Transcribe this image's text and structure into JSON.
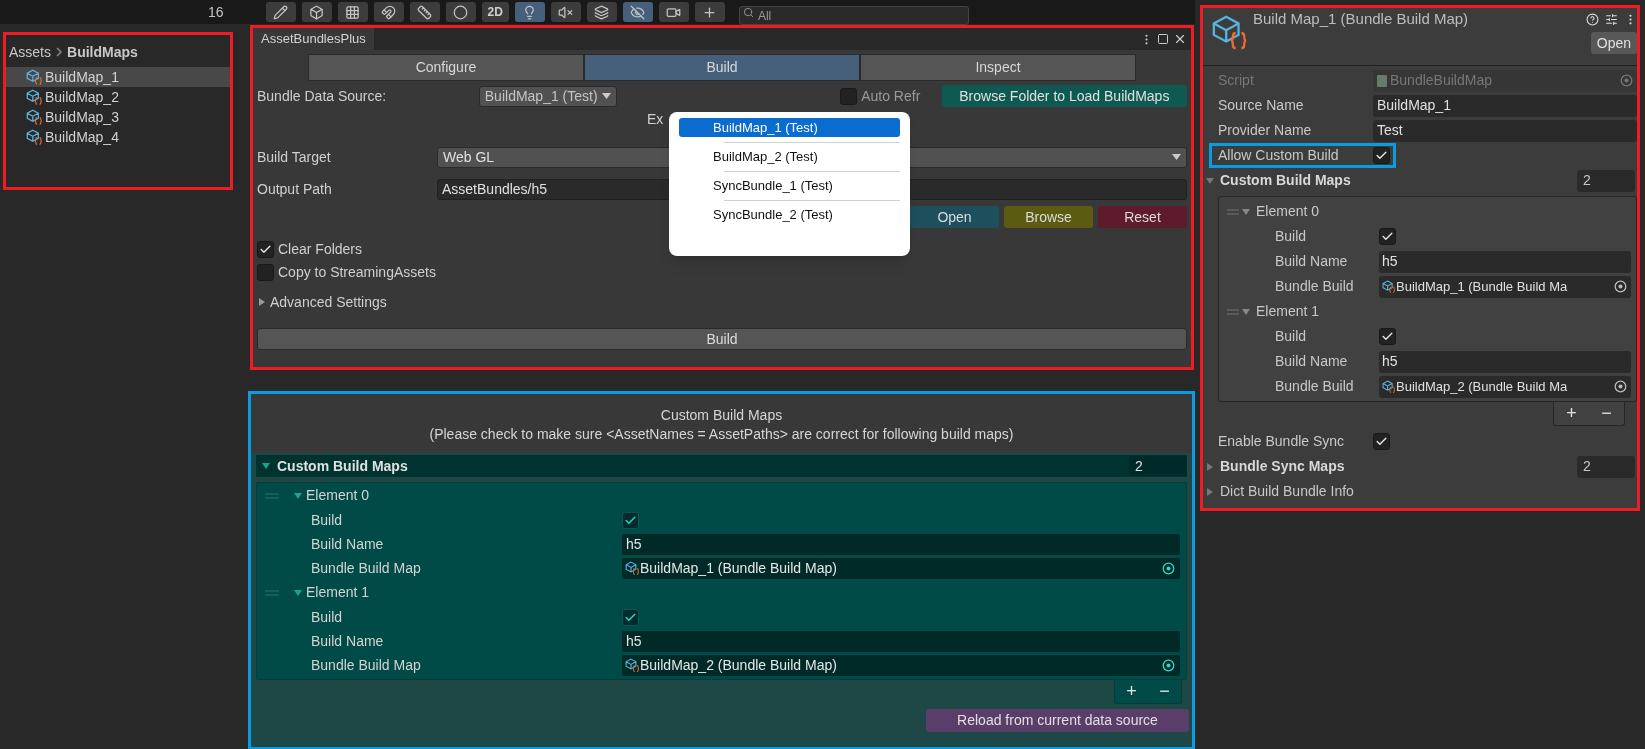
{
  "toolbar": {
    "count": "16",
    "mode_2d": "2D",
    "search": {
      "placeholder": "All"
    },
    "toggles": [
      {
        "kind": "draw",
        "selected": false
      },
      {
        "kind": "gizmo",
        "selected": false
      },
      {
        "kind": "grid",
        "selected": false
      },
      {
        "kind": "snap",
        "selected": false
      },
      {
        "kind": "ruler",
        "selected": false
      },
      {
        "kind": "shading",
        "selected": false
      },
      {
        "kind": "light",
        "selected": true
      },
      {
        "kind": "audio",
        "selected": false
      },
      {
        "kind": "layers",
        "selected": false
      },
      {
        "kind": "hidden",
        "selected": true
      },
      {
        "kind": "camera",
        "selected": false
      },
      {
        "kind": "add",
        "selected": false
      }
    ]
  },
  "project_panel": {
    "breadcrumb": [
      "Assets",
      "BuildMaps"
    ],
    "items": [
      {
        "label": "BuildMap_1",
        "selected": true
      },
      {
        "label": "BuildMap_2",
        "selected": false
      },
      {
        "label": "BuildMap_3",
        "selected": false
      },
      {
        "label": "BuildMap_4",
        "selected": false
      }
    ]
  },
  "bundles_window": {
    "title": "AssetBundlesPlus",
    "tabs": [
      {
        "label": "Configure",
        "selected": false
      },
      {
        "label": "Build",
        "selected": true
      },
      {
        "label": "Inspect",
        "selected": false
      }
    ],
    "data_source": {
      "label": "Bundle Data Source:",
      "value": "BuildMap_1 (Test)"
    },
    "auto_refresh": {
      "label": "Auto Refr",
      "checked": false
    },
    "browse_folder_button": "Browse Folder to Load BuildMaps",
    "export_label": "Ex",
    "build_target": {
      "label": "Build Target",
      "value": "Web GL"
    },
    "output_path": {
      "label": "Output Path",
      "value": "AssetBundles/h5"
    },
    "path_buttons": [
      {
        "label": "Open",
        "color": "#1d4f5c"
      },
      {
        "label": "Browse",
        "color": "#5b5b12"
      },
      {
        "label": "Reset",
        "color": "#5e1b2b"
      }
    ],
    "options": [
      {
        "label": "Clear Folders",
        "checked": true
      },
      {
        "label": "Copy to StreamingAssets",
        "checked": false
      }
    ],
    "advanced": {
      "label": "Advanced Settings",
      "expanded": false
    },
    "build_button": "Build",
    "dropdown": {
      "options": [
        {
          "label": "BuildMap_1 (Test)",
          "selected": true
        },
        {
          "label": "BuildMap_2 (Test)",
          "selected": false
        },
        {
          "label": "SyncBundle_1 (Test)",
          "selected": false
        },
        {
          "label": "SyncBundle_2 (Test)",
          "selected": false
        }
      ]
    }
  },
  "custom_maps_panel": {
    "title": "Custom Build Maps",
    "note": "(Please check to make sure <AssetNames = AssetPaths> are correct for following build maps)",
    "list": {
      "label": "Custom Build Maps",
      "count": "2",
      "expanded": true,
      "elements": [
        {
          "label": "Element 0",
          "expanded": true,
          "build": {
            "label": "Build",
            "checked": true
          },
          "build_name": {
            "label": "Build Name",
            "value": "h5"
          },
          "map": {
            "label": "Bundle Build Map",
            "value": "BuildMap_1 (Bundle Build Map)"
          }
        },
        {
          "label": "Element 1",
          "expanded": true,
          "build": {
            "label": "Build",
            "checked": true
          },
          "build_name": {
            "label": "Build Name",
            "value": "h5"
          },
          "map": {
            "label": "Bundle Build Map",
            "value": "BuildMap_2 (Bundle Build Map)"
          }
        }
      ],
      "add": "+",
      "remove": "−"
    },
    "reload_button": "Reload from current data source"
  },
  "inspector": {
    "title": "Build Map_1 (Bundle Build Map)",
    "open_button": "Open",
    "script": {
      "label": "Script",
      "value": "BundleBuildMap"
    },
    "source_name": {
      "label": "Source Name",
      "value": "BuildMap_1"
    },
    "provider_name": {
      "label": "Provider Name",
      "value": "Test"
    },
    "allow_custom_build": {
      "label": "Allow Custom Build",
      "checked": true
    },
    "custom_list": {
      "label": "Custom Build Maps",
      "count": "2",
      "expanded": true,
      "elements": [
        {
          "label": "Element 0",
          "expanded": true,
          "build": {
            "label": "Build",
            "checked": true
          },
          "build_name": {
            "label": "Build Name",
            "value": "h5"
          },
          "map": {
            "label": "Bundle Build",
            "value": "BuildMap_1 (Bundle Build Ma"
          }
        },
        {
          "label": "Element 1",
          "expanded": true,
          "build": {
            "label": "Build",
            "checked": true
          },
          "build_name": {
            "label": "Build Name",
            "value": "h5"
          },
          "map": {
            "label": "Bundle Build",
            "value": "BuildMap_2 (Bundle Build Ma"
          }
        }
      ],
      "add": "+",
      "remove": "−"
    },
    "enable_sync": {
      "label": "Enable Bundle Sync",
      "checked": true
    },
    "sync_maps": {
      "label": "Bundle Sync Maps",
      "count": "2",
      "expanded": false
    },
    "dict_info": {
      "label": "Dict Build Bundle Info",
      "expanded": false
    }
  }
}
